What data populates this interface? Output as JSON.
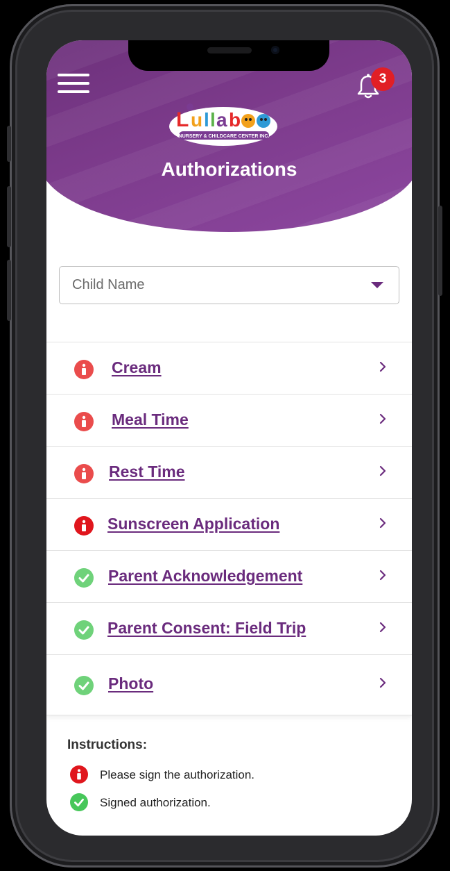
{
  "header": {
    "title": "Authorizations",
    "notification_count": "3",
    "brand": "Lullaboo Nursery & Childcare Center Inc."
  },
  "filter": {
    "child_select": "Child Name"
  },
  "authorizations": [
    {
      "label": "Cream",
      "status": "unsigned"
    },
    {
      "label": "Meal Time",
      "status": "unsigned"
    },
    {
      "label": "Rest Time",
      "status": "unsigned"
    },
    {
      "label": "Sunscreen Application",
      "status": "unsigned"
    },
    {
      "label": "Parent Acknowledgement",
      "status": "signed"
    },
    {
      "label": "Parent Consent: Field Trip",
      "status": "signed"
    },
    {
      "label": "Photo",
      "status": "signed"
    }
  ],
  "instructions": {
    "heading": "Instructions:",
    "unsigned_text": "Please sign the authorization.",
    "signed_text": "Signed authorization."
  },
  "colors": {
    "brand_purple": "#6a2b7d",
    "alert_red": "#ea4c4c",
    "signed_green": "#6fd27a",
    "badge_red": "#e11f25"
  }
}
